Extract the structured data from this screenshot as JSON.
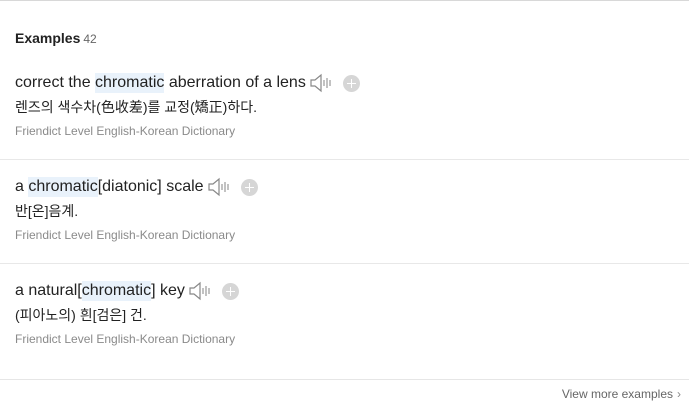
{
  "header": {
    "title": "Examples",
    "count": "42"
  },
  "examples": [
    {
      "sentence_pre": "correct the ",
      "sentence_highlight": "chromatic",
      "sentence_post": " aberration of a lens",
      "translation": "렌즈의 색수차(色收差)를 교정(矯正)하다.",
      "source": "Friendict Level English-Korean Dictionary"
    },
    {
      "sentence_pre": "a ",
      "sentence_highlight": "chromatic",
      "sentence_post": "[diatonic] scale",
      "translation": "반[온]음계.",
      "source": "Friendict Level English-Korean Dictionary"
    },
    {
      "sentence_pre": "a natural[",
      "sentence_highlight": "chromatic",
      "sentence_post": "] key",
      "translation": "(피아노의) 흰[검은] 건.",
      "source": "Friendict Level English-Korean Dictionary"
    }
  ],
  "footer": {
    "view_more_label": "View more examples"
  },
  "icons": {
    "audio": "speaker-icon",
    "add": "plus-circle-icon",
    "more": "chevron-right-icon"
  }
}
